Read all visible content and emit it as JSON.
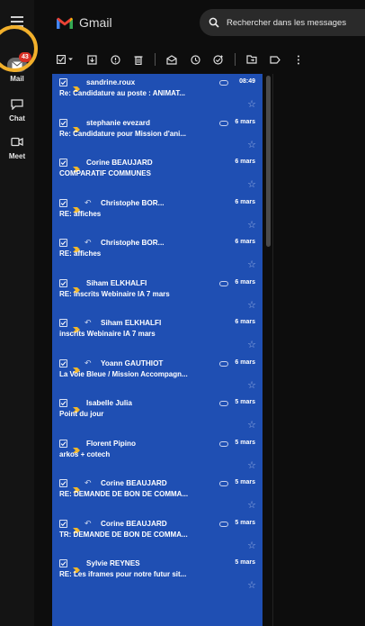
{
  "header": {
    "app_name": "Gmail",
    "search_placeholder": "Rechercher dans les messages"
  },
  "rail": {
    "mail": {
      "label": "Mail",
      "badge": "43"
    },
    "chat": {
      "label": "Chat"
    },
    "meet": {
      "label": "Meet"
    }
  },
  "emails": [
    {
      "sender": "sandrine.roux",
      "subject": "Re: Candidature au poste : ANIMAT...",
      "date": "08:49",
      "reply": false,
      "chat": true
    },
    {
      "sender": "stephanie evezard",
      "subject": "Re: Candidature pour Mission d'ani...",
      "date": "6 mars",
      "reply": false,
      "chat": true
    },
    {
      "sender": "Corine BEAUJARD",
      "subject": "COMPARATIF COMMUNES",
      "date": "6 mars",
      "reply": false,
      "chat": false
    },
    {
      "sender": "Christophe BOR...",
      "subject": "RE: affiches",
      "date": "6 mars",
      "reply": true,
      "chat": false
    },
    {
      "sender": "Christophe BOR...",
      "subject": "RE: affiches",
      "date": "6 mars",
      "reply": true,
      "chat": false
    },
    {
      "sender": "Siham ELKHALFI",
      "subject": "RE: inscrits Webinaire IA 7 mars",
      "date": "6 mars",
      "reply": false,
      "chat": true
    },
    {
      "sender": "Siham ELKHALFI",
      "subject": "inscrits Webinaire IA 7 mars",
      "date": "6 mars",
      "reply": true,
      "chat": false
    },
    {
      "sender": "Yoann GAUTHIOT",
      "subject": "La Voie Bleue / Mission Accompagn...",
      "date": "6 mars",
      "reply": true,
      "chat": true
    },
    {
      "sender": "Isabelle Julia",
      "subject": "Point du jour",
      "date": "5 mars",
      "reply": false,
      "chat": true
    },
    {
      "sender": "Florent Pipino",
      "subject": "arkos + cotech",
      "date": "5 mars",
      "reply": false,
      "chat": true
    },
    {
      "sender": "Corine BEAUJARD",
      "subject": "RE: DEMANDE DE BON DE COMMA...",
      "date": "5 mars",
      "reply": true,
      "chat": true
    },
    {
      "sender": "Corine BEAUJARD",
      "subject": "TR: DEMANDE DE BON DE COMMA...",
      "date": "5 mars",
      "reply": true,
      "chat": true
    },
    {
      "sender": "Sylvie REYNES",
      "subject": "RE: Les iframes pour notre futur sit...",
      "date": "5 mars",
      "reply": false,
      "chat": false
    }
  ],
  "colors": {
    "selection_blue": "#1f4fb3",
    "highlight_ring": "#f2b02b",
    "badge_red": "#d93025",
    "importance_yellow": "#f2b82b"
  },
  "icons": [
    "menu-icon",
    "gmail-logo-icon",
    "search-icon",
    "select-all-checkbox",
    "archive-icon",
    "report-spam-icon",
    "delete-icon",
    "mark-unread-icon",
    "snooze-icon",
    "add-task-icon",
    "move-to-icon",
    "label-icon",
    "more-icon",
    "mail-icon",
    "chat-icon",
    "meet-icon",
    "star-icon",
    "importance-icon",
    "reply-icon"
  ]
}
